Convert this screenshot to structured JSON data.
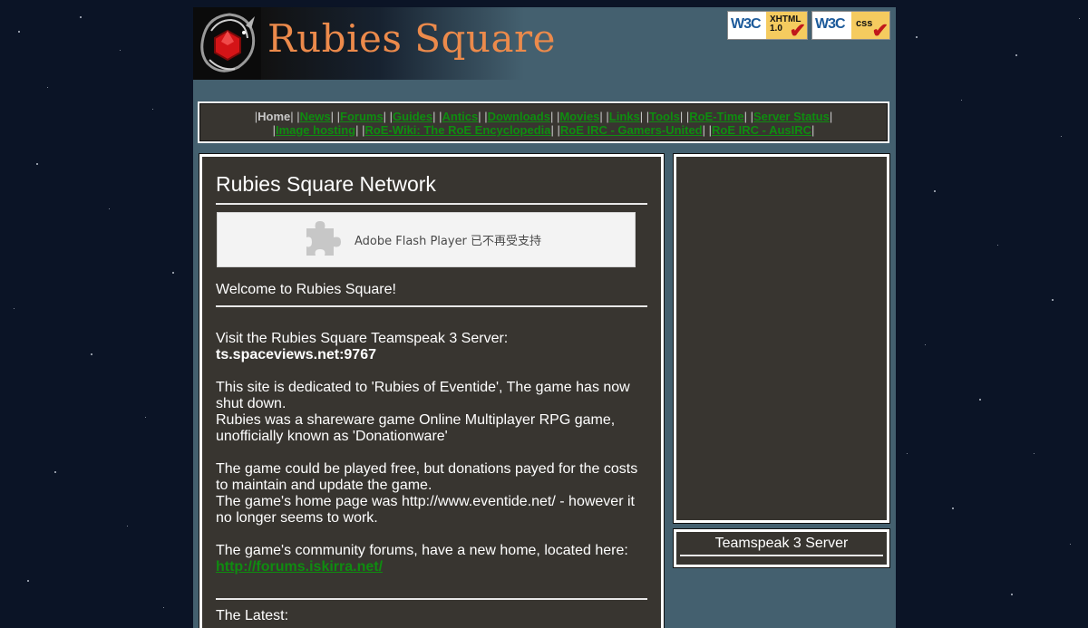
{
  "site": {
    "title": "Rubies Square",
    "badges": {
      "xhtml": {
        "mark": "W3C",
        "label_line1": "XHTML",
        "label_line2": "1.0"
      },
      "css": {
        "mark": "W3C",
        "label": "css"
      }
    }
  },
  "nav": {
    "row1": [
      {
        "label": "Home",
        "current": true
      },
      {
        "label": "News"
      },
      {
        "label": "Forums"
      },
      {
        "label": "Guides"
      },
      {
        "label": "Antics"
      },
      {
        "label": "Downloads"
      },
      {
        "label": "Movies"
      },
      {
        "label": "Links"
      },
      {
        "label": "Tools"
      },
      {
        "label": "RoE-Time"
      },
      {
        "label": "Server Status"
      }
    ],
    "row2": [
      {
        "label": "Image hosting"
      },
      {
        "label": "RoE-Wiki: The RoE Encyclopedia"
      },
      {
        "label": "RoE IRC - Gamers-United"
      },
      {
        "label": "RoE IRC - AusIRC"
      }
    ]
  },
  "main": {
    "title": "Rubies Square Network",
    "flash_message": "Adobe Flash Player 已不再受支持",
    "welcome": "Welcome to Rubies Square!",
    "ts_intro": "Visit the Rubies Square Teamspeak 3 Server:",
    "ts_address": "ts.spaceviews.net:9767",
    "p_dedicated": "This site is dedicated to 'Rubies of Eventide', The game has now shut down.",
    "p_shareware": "Rubies was a shareware game Online Multiplayer RPG game, unofficially known as 'Donationware'",
    "p_free": "The game could be played free, but donations payed for the costs to maintain and update the game.",
    "p_homepage": "The game's home page was http://www.eventide.net/ - however it no longer seems to work.",
    "p_forums": "The game's community forums, have a new home, located here:",
    "forums_link": "http://forums.iskirra.net/",
    "latest_heading": "The Latest:"
  },
  "sidebar": {
    "ts_title": "Teamspeak 3 Server"
  },
  "colors": {
    "page_bg": "#0b1426",
    "content_bg": "#44606f",
    "panel_bg": "#383530",
    "link": "#0f8c10",
    "title_orange": "#ec8a4b"
  }
}
